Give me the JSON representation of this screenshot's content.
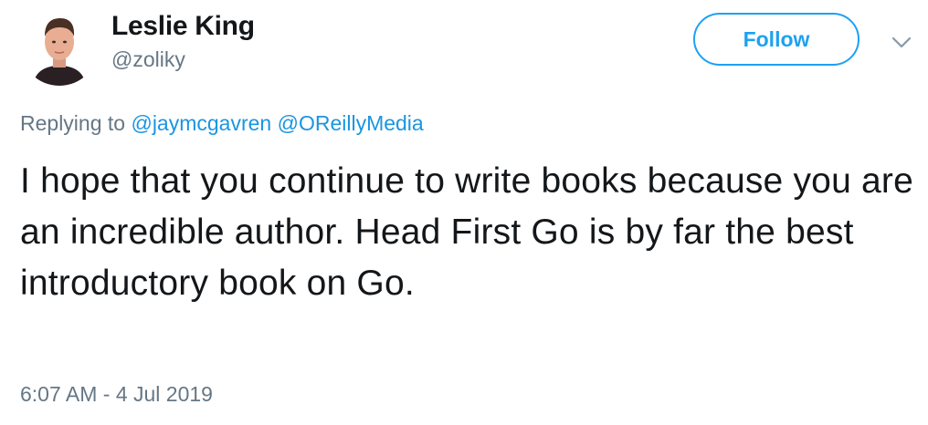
{
  "author": {
    "name": "Leslie King",
    "handle": "@zoliky"
  },
  "follow_button": {
    "label": "Follow"
  },
  "menu": {
    "icon": "chevron-down-icon"
  },
  "reply": {
    "prefix": "Replying to",
    "mentions": [
      "@jaymcgavren",
      "@OReillyMedia"
    ]
  },
  "tweet": {
    "text": "I hope that you continue to write books because you are an incredible author. Head First Go is by far the best introductory book on Go.",
    "timestamp": "6:07 AM - 4 Jul 2019"
  },
  "colors": {
    "accent": "#1da1f2",
    "link": "#1b95e0",
    "secondary_text": "#657786",
    "primary_text": "#14171a"
  }
}
